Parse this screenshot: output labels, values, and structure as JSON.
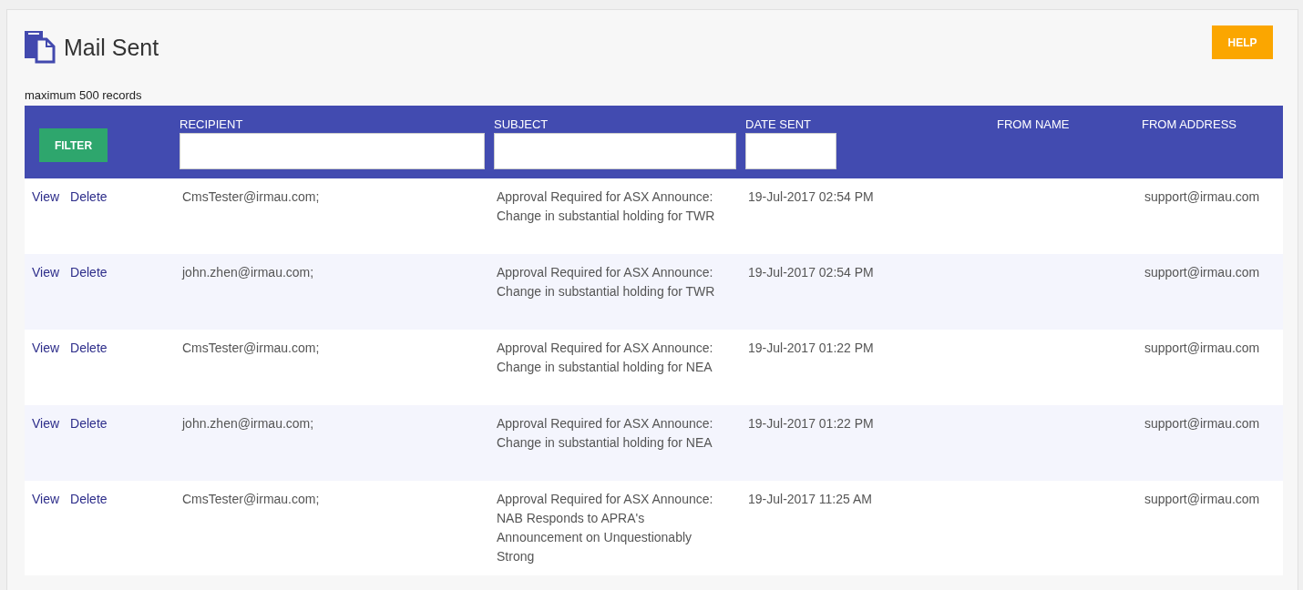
{
  "page": {
    "title": "Mail Sent",
    "help_button": "HELP",
    "record_note": "maximum 500 records"
  },
  "table": {
    "filter_button": "FILTER",
    "columns": [
      {
        "label": "RECIPIENT",
        "kind": "wide"
      },
      {
        "label": "SUBJECT",
        "kind": "medium"
      },
      {
        "label": "DATE SENT",
        "kind": "narrow"
      },
      {
        "label": "FROM NAME",
        "kind": "none"
      },
      {
        "label": "FROM ADDRESS",
        "kind": "none"
      }
    ],
    "rows": [
      {
        "actions": [
          "View",
          "Delete"
        ],
        "recipient": "CmsTester@irmau.com;",
        "subject": "Approval Required for ASX Announce: Change in substantial holding for TWR",
        "date_sent": "19-Jul-2017 02:54 PM",
        "from_address": "support@irmau.com"
      },
      {
        "actions": [
          "View",
          "Delete"
        ],
        "recipient": "john.zhen@irmau.com;",
        "subject": "Approval Required for ASX Announce: Change in substantial holding for TWR",
        "date_sent": "19-Jul-2017 02:54 PM",
        "from_address": "support@irmau.com"
      },
      {
        "actions": [
          "View",
          "Delete"
        ],
        "recipient": "CmsTester@irmau.com;",
        "subject": "Approval Required for ASX Announce: Change in substantial holding for NEA",
        "date_sent": "19-Jul-2017 01:22 PM",
        "from_address": "support@irmau.com"
      },
      {
        "actions": [
          "View",
          "Delete"
        ],
        "recipient": "john.zhen@irmau.com;",
        "subject": "Approval Required for ASX Announce: Change in substantial holding for NEA",
        "date_sent": "19-Jul-2017 01:22 PM",
        "from_address": "support@irmau.com"
      },
      {
        "actions": [
          "View",
          "Delete"
        ],
        "recipient": "CmsTester@irmau.com;",
        "subject": "Approval Required for ASX Announce: NAB Responds to APRA's Announcement on Unquestionably Strong",
        "date_sent": "19-Jul-2017 11:25 AM",
        "from_address": "support@irmau.com"
      }
    ]
  }
}
